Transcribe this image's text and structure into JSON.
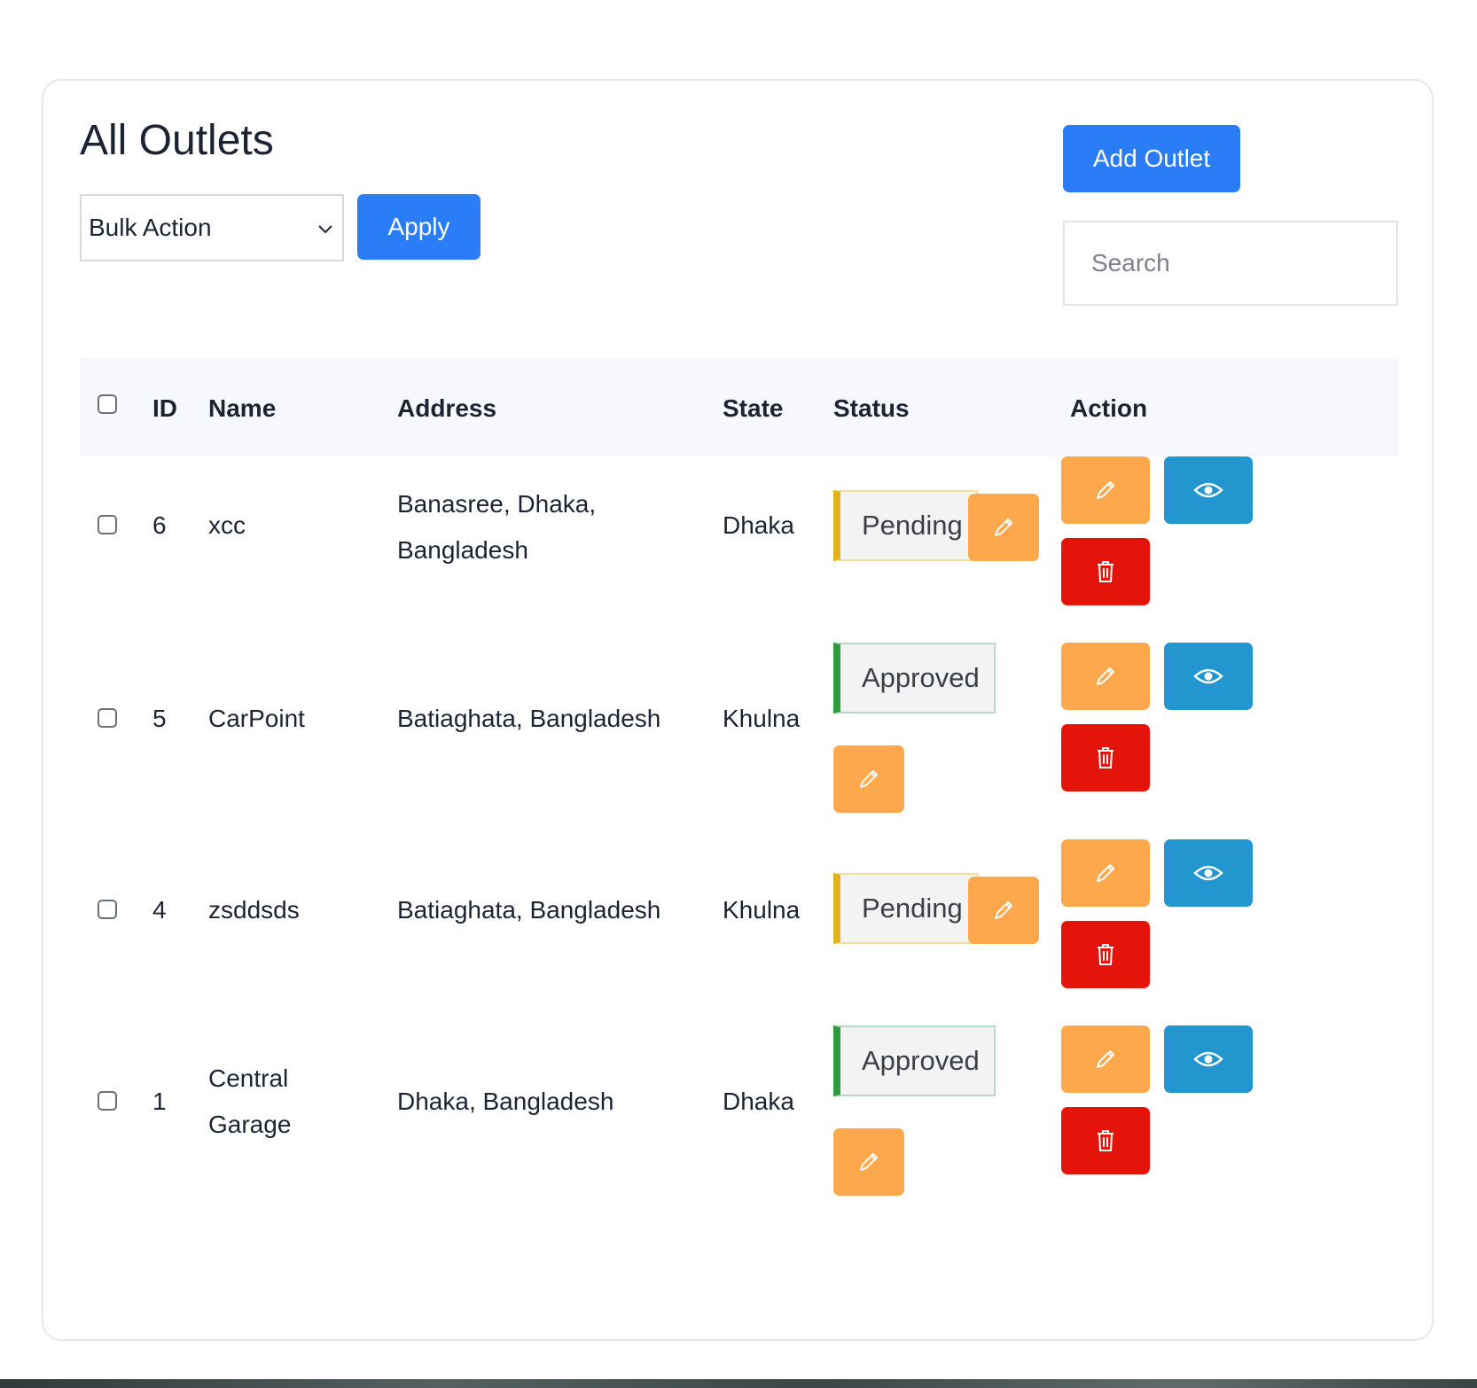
{
  "page": {
    "title": "All Outlets"
  },
  "toolbar": {
    "bulk_action_selected": "Bulk Action",
    "apply_label": "Apply",
    "add_outlet_label": "Add Outlet",
    "search_placeholder": "Search",
    "search_value": ""
  },
  "table": {
    "headers": {
      "id": "ID",
      "name": "Name",
      "address": "Address",
      "state": "State",
      "status": "Status",
      "action": "Action"
    },
    "rows": [
      {
        "id": "6",
        "name": "xcc",
        "address": "Banasree, Dhaka,\nBangladesh",
        "state": "Dhaka",
        "status": "Pending"
      },
      {
        "id": "5",
        "name": "CarPoint",
        "address": "Batiaghata, Bangladesh",
        "state": "Khulna",
        "status": "Approved"
      },
      {
        "id": "4",
        "name": "zsddsds",
        "address": "Batiaghata, Bangladesh",
        "state": "Khulna",
        "status": "Pending"
      },
      {
        "id": "1",
        "name": "Central\nGarage",
        "address": "Dhaka, Bangladesh",
        "state": "Dhaka",
        "status": "Approved"
      }
    ]
  },
  "icons": {
    "status_edit": "pencil-icon",
    "edit": "pencil-icon",
    "view": "eye-icon",
    "delete": "trash-icon",
    "dropdown": "chevron-down-icon"
  },
  "colors": {
    "primary": "#2a7cf7",
    "edit": "#fea84d",
    "view": "#2396cf",
    "delete": "#e5140a",
    "pending_accent": "#e2b219",
    "approved_accent": "#2e9c3c",
    "header_bg": "#f6f8fd"
  }
}
